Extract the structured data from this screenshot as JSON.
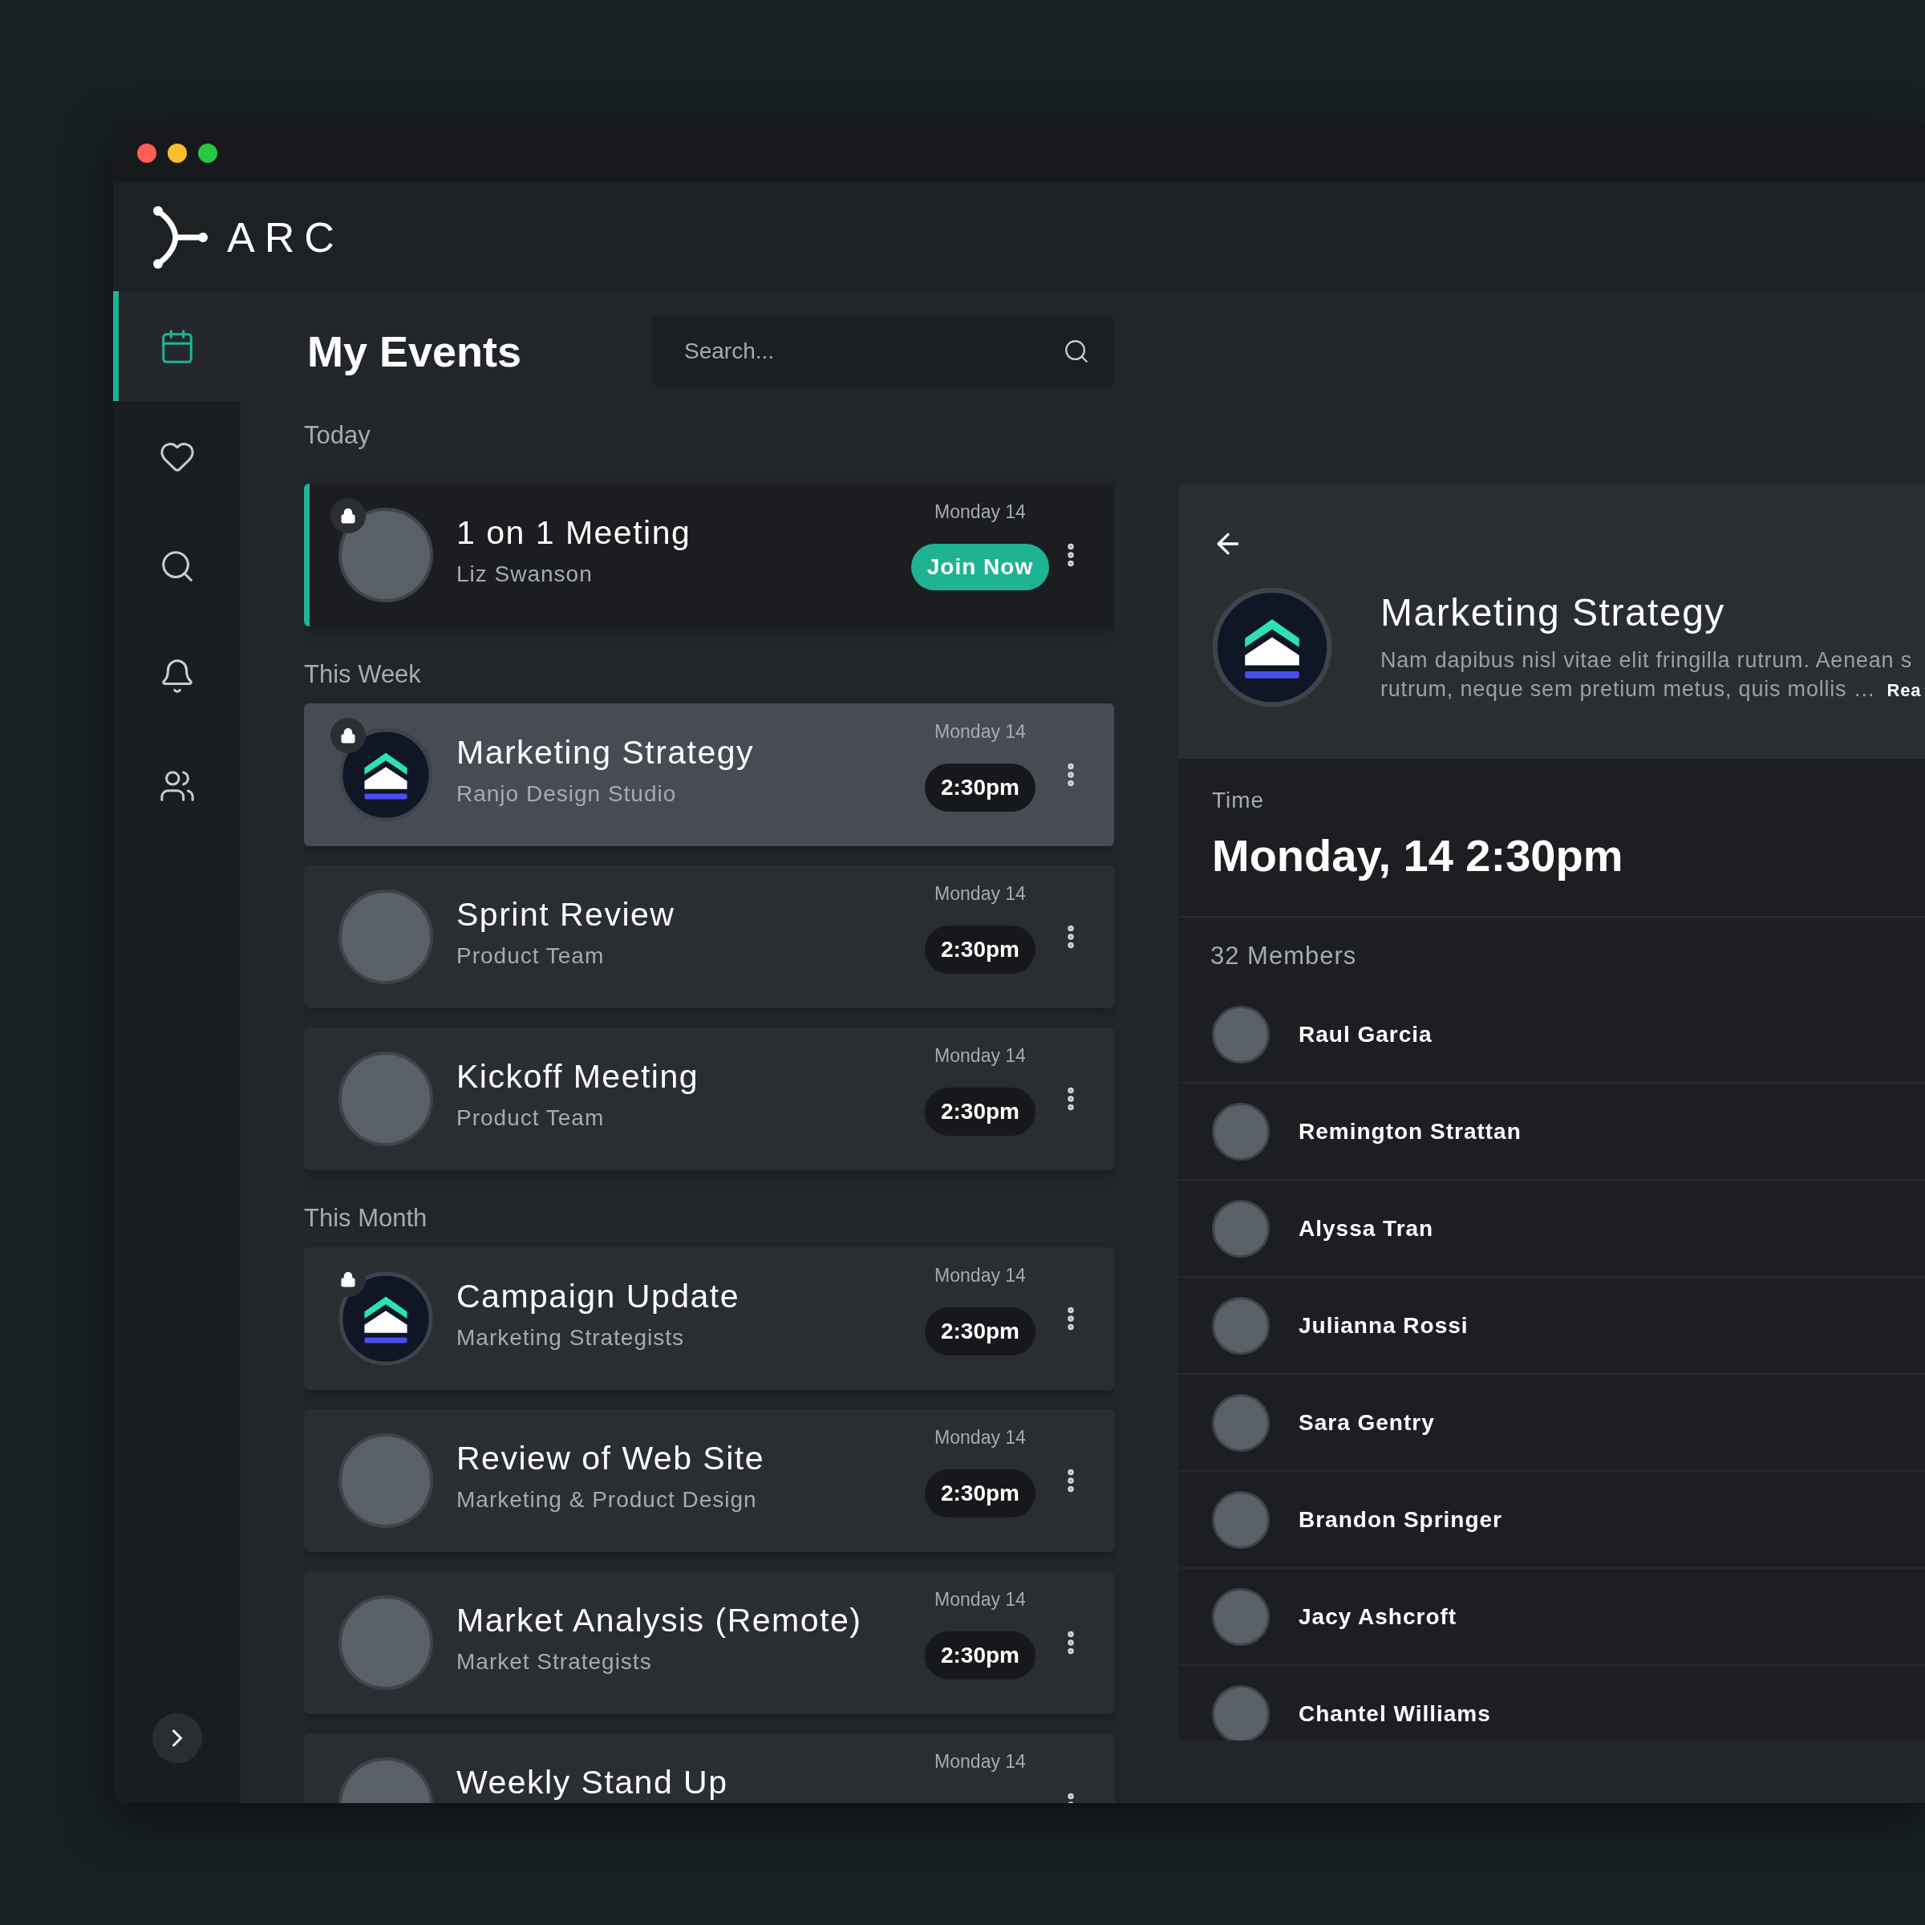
{
  "app": {
    "name": "ARC"
  },
  "sidebar": {
    "items": [
      {
        "kind": "calendar",
        "selected": true
      },
      {
        "kind": "heart",
        "selected": false
      },
      {
        "kind": "search",
        "selected": false
      },
      {
        "kind": "bell",
        "selected": false
      },
      {
        "kind": "users",
        "selected": false
      }
    ]
  },
  "page": {
    "title": "My Events",
    "search": {
      "placeholder": "Search..."
    }
  },
  "sections": [
    {
      "label": "Today",
      "events": [
        {
          "title": "1 on 1 Meeting",
          "subtitle": "Liz Swanson",
          "date": "Monday 14",
          "action": {
            "kind": "join",
            "label": "Join Now"
          },
          "avatar": {
            "kind": "photo"
          },
          "locked": true,
          "ongoing": true,
          "selected": false
        }
      ]
    },
    {
      "label": "This Week",
      "events": [
        {
          "title": "Marketing Strategy",
          "subtitle": "Ranjo Design Studio",
          "date": "Monday 14",
          "action": {
            "kind": "time",
            "label": "2:30pm"
          },
          "avatar": {
            "kind": "logo"
          },
          "locked": true,
          "ongoing": false,
          "selected": true
        },
        {
          "title": "Sprint Review",
          "subtitle": "Product Team",
          "date": "Monday 14",
          "action": {
            "kind": "time",
            "label": "2:30pm"
          },
          "avatar": {
            "kind": "photo"
          },
          "locked": false,
          "ongoing": false,
          "selected": false
        },
        {
          "title": "Kickoff Meeting",
          "subtitle": "Product Team",
          "date": "Monday 14",
          "action": {
            "kind": "time",
            "label": "2:30pm"
          },
          "avatar": {
            "kind": "photo"
          },
          "locked": false,
          "ongoing": false,
          "selected": false
        }
      ]
    },
    {
      "label": "This Month",
      "events": [
        {
          "title": "Campaign Update",
          "subtitle": "Marketing Strategists",
          "date": "Monday 14",
          "action": {
            "kind": "time",
            "label": "2:30pm"
          },
          "avatar": {
            "kind": "logo"
          },
          "locked": true,
          "ongoing": false,
          "selected": false
        },
        {
          "title": "Review of Web Site",
          "subtitle": "Marketing & Product Design",
          "date": "Monday 14",
          "action": {
            "kind": "time",
            "label": "2:30pm"
          },
          "avatar": {
            "kind": "photo"
          },
          "locked": false,
          "ongoing": false,
          "selected": false
        },
        {
          "title": "Market Analysis (Remote)",
          "subtitle": "Market Strategists",
          "date": "Monday 14",
          "action": {
            "kind": "time",
            "label": "2:30pm"
          },
          "avatar": {
            "kind": "photo"
          },
          "locked": false,
          "ongoing": false,
          "selected": false
        },
        {
          "title": "Weekly Stand Up",
          "date": "Monday 14",
          "avatar": {
            "kind": "photo"
          },
          "locked": false,
          "ongoing": false,
          "selected": false
        }
      ]
    }
  ],
  "detail": {
    "title": "Marketing Strategy",
    "description_lines": [
      "Nam dapibus nisl vitae elit fringilla rutrum. Aenean s",
      "rutrum, neque sem pretium metus, quis mollis …"
    ],
    "read_more": "Rea",
    "avatar": {
      "kind": "logo"
    },
    "time_label": "Time",
    "time_value": "Monday, 14 2:30pm",
    "members_label": "32 Members",
    "members": [
      "Raul Garcia",
      "Remington Strattan",
      "Alyssa Tran",
      "Julianna Rossi",
      "Sara Gentry",
      "Brandon Springer",
      "Jacy Ashcroft",
      "Chantel Williams"
    ]
  }
}
